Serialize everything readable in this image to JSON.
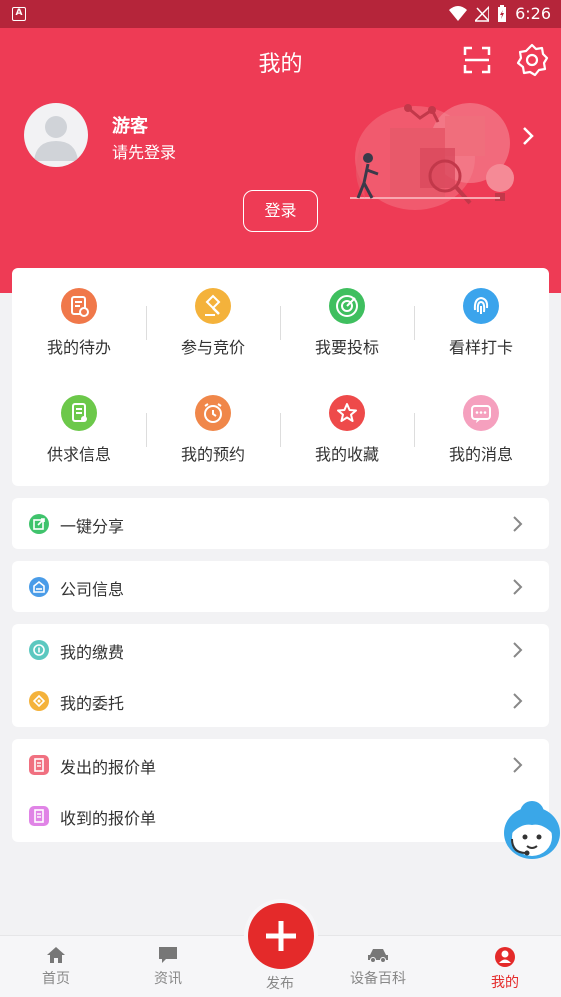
{
  "status": {
    "time": "6:26"
  },
  "header": {
    "title": "我的",
    "user_name": "游客",
    "user_sub": "请先登录",
    "login_label": "登录"
  },
  "grid": [
    {
      "label": "我的待办",
      "color": "#f0784a"
    },
    {
      "label": "参与竞价",
      "color": "#f4b23b"
    },
    {
      "label": "我要投标",
      "color": "#3fbf5f"
    },
    {
      "label": "看样打卡",
      "color": "#3ba4ec"
    },
    {
      "label": "供求信息",
      "color": "#6cc84a"
    },
    {
      "label": "我的预约",
      "color": "#f0874a"
    },
    {
      "label": "我的收藏",
      "color": "#ee4a4a"
    },
    {
      "label": "我的消息",
      "color": "#f5a0be"
    }
  ],
  "menu": {
    "share": "一键分享",
    "company": "公司信息",
    "fees": "我的缴费",
    "entrust": "我的委托",
    "sent_quotes": "发出的报价单",
    "received_quotes": "收到的报价单"
  },
  "colors": {
    "brand": "#ee3b55",
    "statusbar": "#b5253a",
    "active_tab": "#e42a2a"
  },
  "tabs": [
    {
      "label": "首页",
      "icon": "home-icon"
    },
    {
      "label": "资讯",
      "icon": "news-icon"
    },
    {
      "label": "发布",
      "icon": "plus-icon"
    },
    {
      "label": "设备百科",
      "icon": "car-icon"
    },
    {
      "label": "我的",
      "icon": "user-icon"
    }
  ]
}
